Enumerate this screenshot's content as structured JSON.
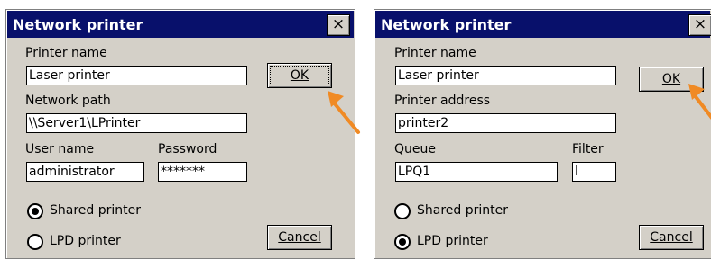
{
  "dialogs": [
    {
      "title": "Network printer",
      "close_icon": "×",
      "printer_name_label": "Printer name",
      "printer_name_value": "Laser printer",
      "second_label": "Network path",
      "second_value": "\\\\Server1\\LPrinter",
      "third_label": "User name",
      "third_value": "administrator",
      "fourth_label": "Password",
      "fourth_value": "*******",
      "ok_label": "OK",
      "cancel_label": "Cancel",
      "radio_shared_label": "Shared printer",
      "radio_lpd_label": "LPD printer",
      "selected_radio": "shared"
    },
    {
      "title": "Network printer",
      "close_icon": "×",
      "printer_name_label": "Printer name",
      "printer_name_value": "Laser printer",
      "second_label": "Printer address",
      "second_value": "printer2",
      "third_label": "Queue",
      "third_value": "LPQ1",
      "fourth_label": "Filter",
      "fourth_value": "l",
      "ok_label": "OK",
      "cancel_label": "Cancel",
      "radio_shared_label": "Shared printer",
      "radio_lpd_label": "LPD printer",
      "selected_radio": "lpd"
    }
  ],
  "colors": {
    "titlebar": "#08106b",
    "dialog_bg": "#d4d0c8",
    "arrow": "#f08a24"
  },
  "icons": [
    "close-icon",
    "pointer-arrow-icon",
    "radio-icon"
  ]
}
